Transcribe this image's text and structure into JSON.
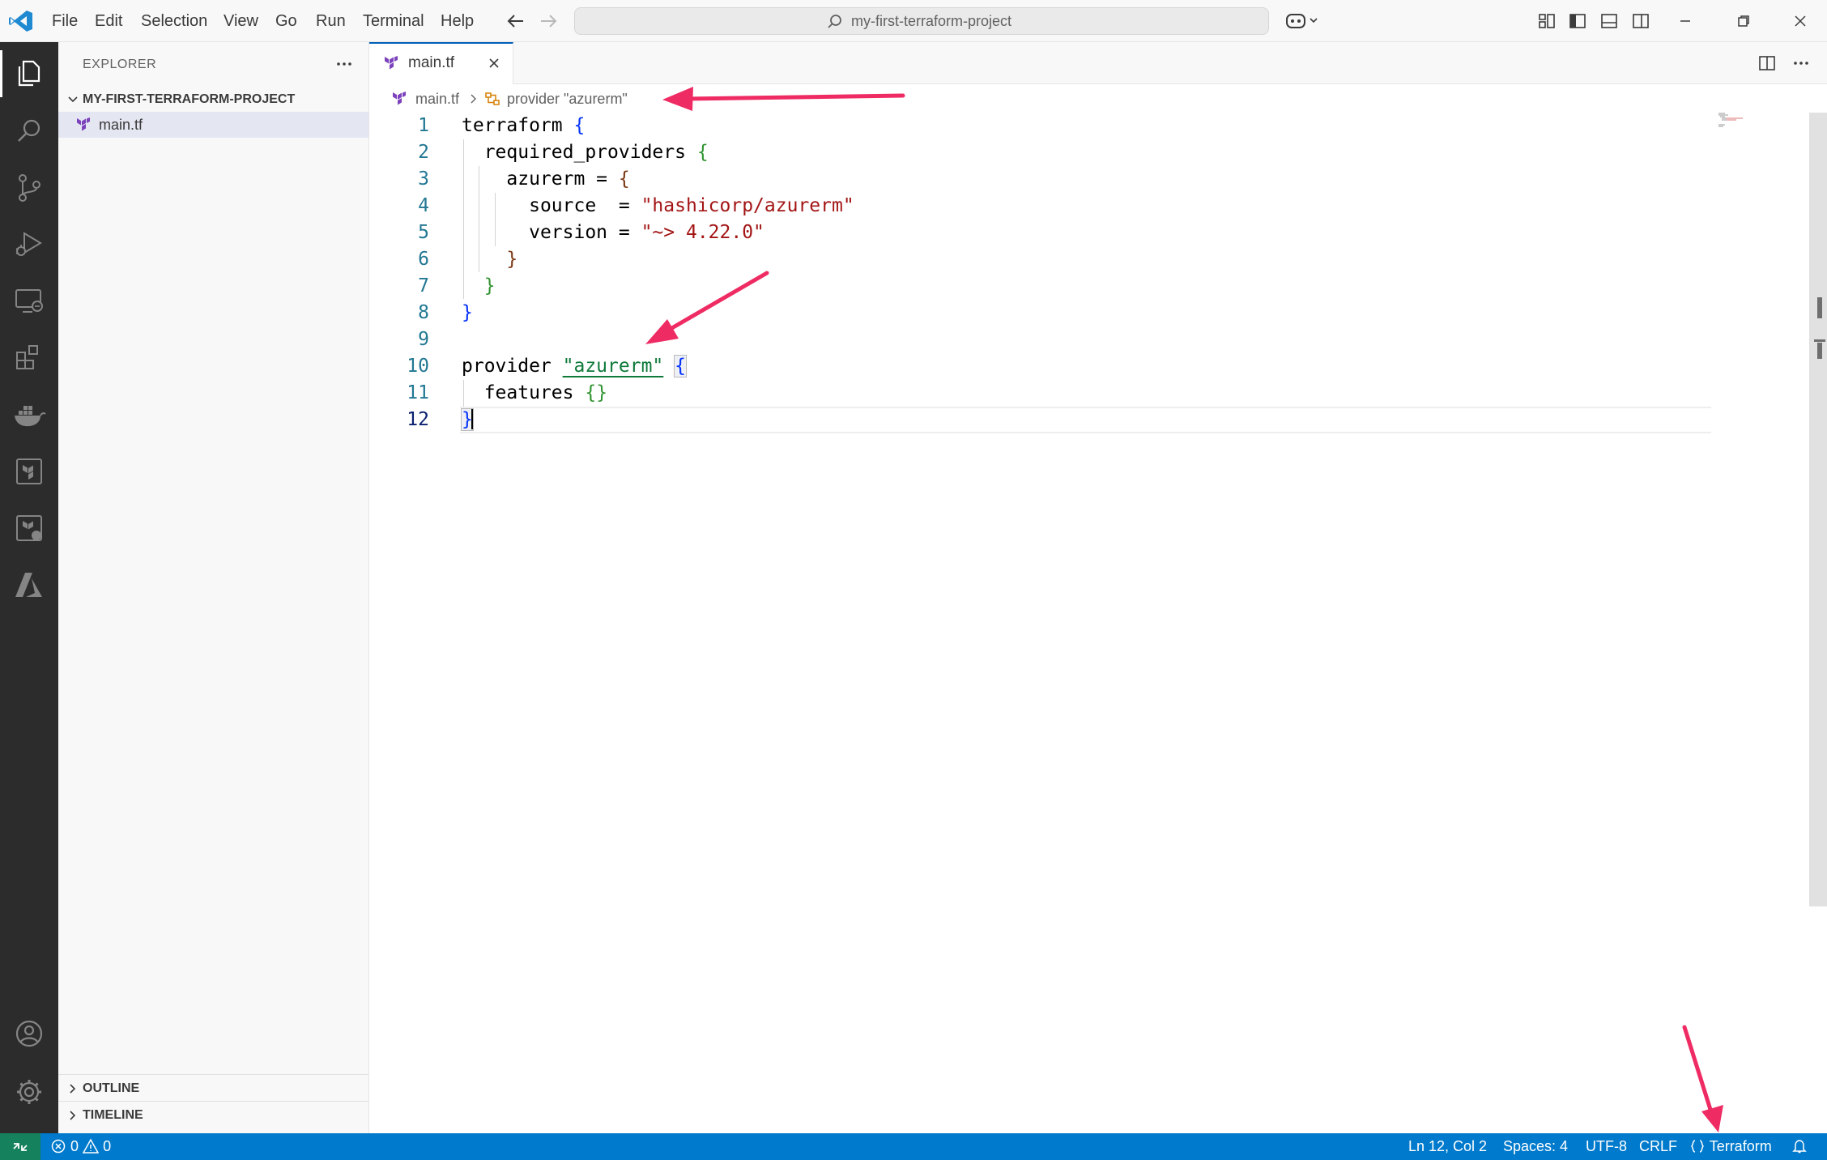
{
  "window": {
    "menu": [
      "File",
      "Edit",
      "Selection",
      "View",
      "Go",
      "Run",
      "Terminal",
      "Help"
    ],
    "search": "my-first-terraform-project"
  },
  "sidebar": {
    "title": "EXPLORER",
    "folder": "MY-FIRST-TERRAFORM-PROJECT",
    "file": "main.tf",
    "sections": [
      "OUTLINE",
      "TIMELINE"
    ]
  },
  "editor": {
    "tab_label": "main.tf",
    "breadcrumb": [
      "main.tf",
      "provider \"azurerm\""
    ],
    "line_numbers": [
      "1",
      "2",
      "3",
      "4",
      "5",
      "6",
      "7",
      "8",
      "9",
      "10",
      "11",
      "12"
    ],
    "code": {
      "l1_kw": "terraform",
      "l2_kw": "required_providers",
      "l3_kw": "azurerm",
      "l4_kw": "source",
      "l4_val": "\"hashicorp/azurerm\"",
      "l5_kw": "version",
      "l5_val": "\"~> 4.22.0\"",
      "l10_kw": "provider",
      "l10_val": "\"azurerm\"",
      "l11_kw": "features"
    }
  },
  "statusbar": {
    "errors": "0",
    "warnings": "0",
    "position": "Ln 12, Col 2",
    "spaces": "Spaces: 4",
    "encoding": "UTF-8",
    "eol": "CRLF",
    "language": "Terraform"
  },
  "colors": {
    "statusbar": "#007acc",
    "remote": "#16825d",
    "activitybar": "#2c2c2c",
    "annotation_arrow": "#ef2b63",
    "terraform_purple": "#7b42bc"
  }
}
